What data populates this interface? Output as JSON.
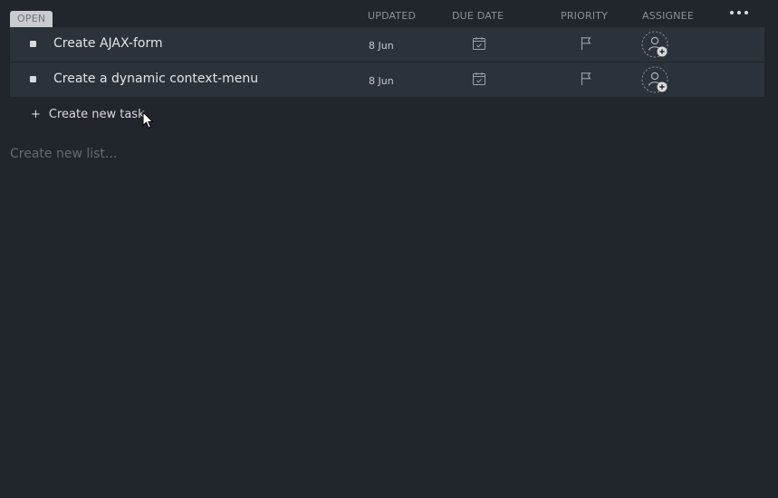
{
  "list": {
    "status_label": "OPEN",
    "columns": {
      "updated": "UPDATED",
      "due_date": "DUE DATE",
      "priority": "PRIORITY",
      "assignee": "ASSIGNEE"
    },
    "more_icon": "more-horizontal-icon"
  },
  "tasks": [
    {
      "title": "Create AJAX-form",
      "updated": "8 Jun"
    },
    {
      "title": "Create a dynamic context-menu",
      "updated": "8 Jun"
    }
  ],
  "actions": {
    "create_task_plus": "+",
    "create_task_label": "Create new task",
    "create_list_placeholder": "Create new list..."
  },
  "icons": {
    "due_date": "calendar-icon",
    "priority": "flag-icon",
    "assignee": "add-assignee-icon"
  },
  "colors": {
    "background": "#21262c",
    "row": "#2c3239",
    "status_tag": "#c9cccf"
  }
}
